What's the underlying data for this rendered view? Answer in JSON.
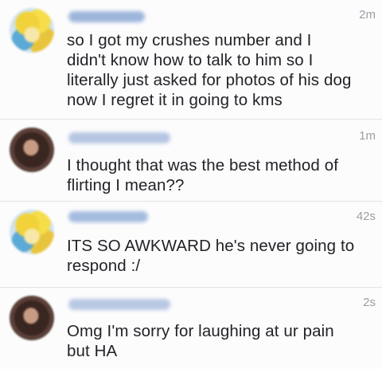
{
  "comments": [
    {
      "time": "2m",
      "lines": [
        "so I got my crushes number and I",
        "didn't know how to talk to him so I",
        "literally just asked for photos of his dog",
        "now I regret it in going to kms"
      ]
    },
    {
      "time": "1m",
      "lines": [
        "I thought that was the best method of",
        "flirting I mean??"
      ]
    },
    {
      "time": "42s",
      "lines": [
        "ITS SO AWKWARD he's never going to",
        "respond :/"
      ]
    },
    {
      "time": "2s",
      "lines": [
        "Omg I'm sorry for laughing at ur pain",
        "but HA"
      ]
    }
  ]
}
